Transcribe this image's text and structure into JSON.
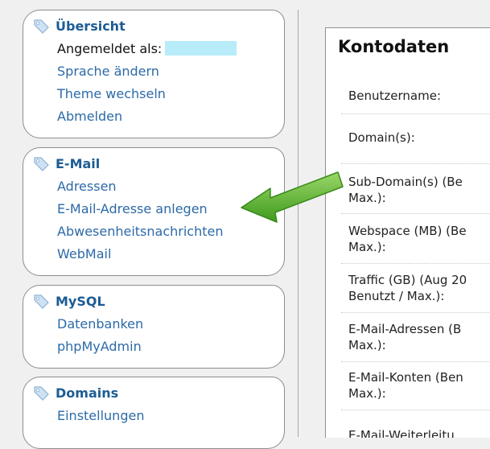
{
  "sidebar": {
    "overview": {
      "title": "Übersicht",
      "logged_in_label": "Angemeldet als:",
      "items": [
        "Sprache ändern",
        "Theme wechseln",
        "Abmelden"
      ]
    },
    "email": {
      "title": "E-Mail",
      "items": [
        "Adressen",
        "E-Mail-Adresse anlegen",
        "Abwesenheitsnachrichten",
        "WebMail"
      ]
    },
    "mysql": {
      "title": "MySQL",
      "items": [
        "Datenbanken",
        "phpMyAdmin"
      ]
    },
    "domains": {
      "title": "Domains",
      "items": [
        "Einstellungen"
      ]
    }
  },
  "main": {
    "title": "Kontodaten",
    "rows": [
      "Benutzername:",
      "Domain(s):",
      "Sub-Domain(s) (Be\nMax.):",
      "Webspace (MB) (Be\nMax.):",
      "Traffic (GB) (Aug 20\nBenutzt / Max.):",
      "E-Mail-Adressen (B\nMax.):",
      "E-Mail-Konten (Ben\nMax.):",
      "E-Mail-Weiterleitu"
    ]
  },
  "colors": {
    "link": "#2c6aa8",
    "heading": "#1d5c94",
    "arrow": "#5cb82e",
    "username_mask": "#b7ecf8"
  },
  "icons": {
    "section_tag": "tag-icon",
    "pointer": "green-arrow-icon"
  }
}
